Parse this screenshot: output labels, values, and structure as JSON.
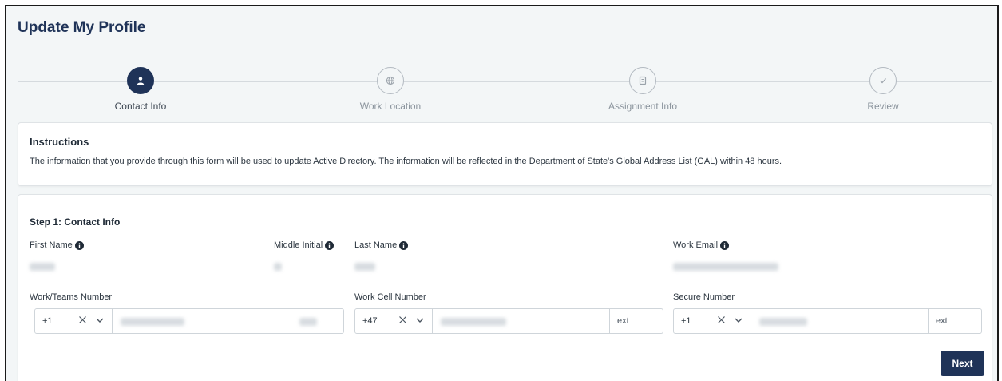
{
  "page": {
    "title": "Update My Profile"
  },
  "stepper": {
    "steps": [
      {
        "label": "Contact Info",
        "icon": "person-icon",
        "state": "active"
      },
      {
        "label": "Work Location",
        "icon": "globe-icon",
        "state": "upcoming"
      },
      {
        "label": "Assignment Info",
        "icon": "badge-icon",
        "state": "upcoming"
      },
      {
        "label": "Review",
        "icon": "check-icon",
        "state": "upcoming"
      }
    ]
  },
  "instructions": {
    "title": "Instructions",
    "text": "The information that you provide through this form will be used to update Active Directory. The information will be reflected in the Department of State's Global Address List (GAL) within 48 hours."
  },
  "form": {
    "step_title": "Step 1: Contact Info",
    "fields": {
      "first_name": {
        "label": "First Name"
      },
      "middle_initial": {
        "label": "Middle Initial"
      },
      "last_name": {
        "label": "Last Name"
      },
      "work_email": {
        "label": "Work Email"
      }
    },
    "phones": {
      "work_teams": {
        "label": "Work/Teams Number",
        "code": "+1",
        "ext_placeholder": ""
      },
      "work_cell": {
        "label": "Work Cell Number",
        "code": "+47",
        "ext_placeholder": "ext"
      },
      "secure": {
        "label": "Secure Number",
        "code": "+1",
        "ext_placeholder": "ext"
      }
    },
    "next_label": "Next"
  },
  "colors": {
    "primary": "#1f3358",
    "border": "#cfd5da",
    "background": "#f3f6f7"
  }
}
